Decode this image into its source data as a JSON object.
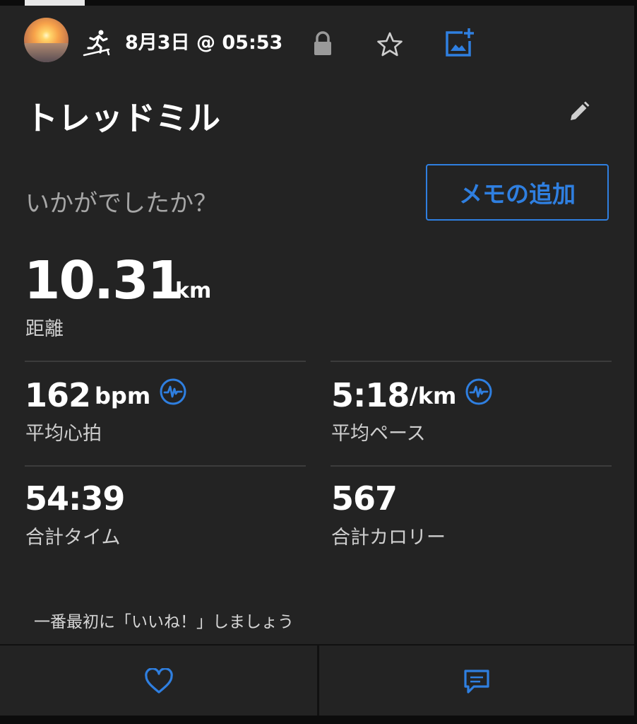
{
  "header": {
    "datetime": "8月3日 @ 05:53",
    "activity_icon": "treadmill-runner-icon",
    "privacy_icon": "lock-icon",
    "favorite_icon": "star-outline-icon",
    "add_photo_icon": "add-photo-icon"
  },
  "activity": {
    "title": "トレッドミル",
    "edit_icon": "pencil-icon"
  },
  "feeling": {
    "prompt": "いかがでしたか？",
    "memo_button": "メモの追加"
  },
  "distance": {
    "value": "10.31",
    "unit": "km",
    "label": "距離"
  },
  "stats": {
    "avg_hr": {
      "value": "162",
      "unit": "bpm",
      "label": "平均心拍",
      "icon": "heart-rate-badge-icon"
    },
    "avg_pace": {
      "value": "5:18",
      "unit": "/km",
      "label": "平均ペース",
      "icon": "heart-rate-badge-icon"
    },
    "total_time": {
      "value": "54:39",
      "label": "合計タイム"
    },
    "total_calories": {
      "value": "567",
      "label": "合計カロリー"
    }
  },
  "social": {
    "like_prompt": "一番最初に「いいね！」しましょう",
    "like_icon": "heart-outline-icon",
    "comment_icon": "comment-icon"
  },
  "colors": {
    "background": "#232323",
    "accent": "#2f7fe0",
    "text": "#ffffff",
    "muted": "#a6a6a6"
  }
}
